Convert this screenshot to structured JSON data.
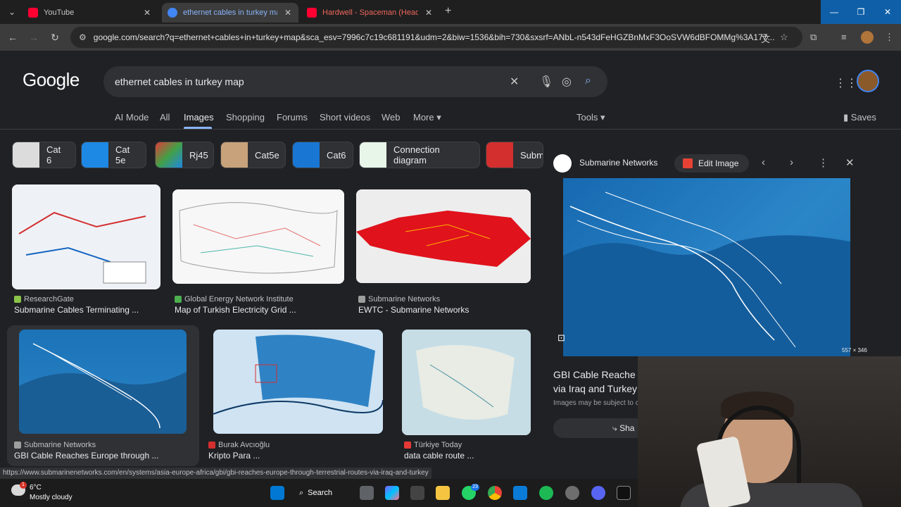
{
  "browser": {
    "tabs": [
      {
        "title": "YouTube",
        "color": "#ff0033"
      },
      {
        "title": "ethernet cables in turkey map",
        "color": "#4285f4"
      },
      {
        "title": "Hardwell - Spaceman (Headhu",
        "color": "#ff0033"
      }
    ],
    "url": "google.com/search?q=ethernet+cables+in+turkey+map&sca_esv=7996c7c19c681191&udm=2&biw=1536&bih=730&sxsrf=ANbL-n543dFeHGZBnMxF3OoSVW6dBFOMMg%3A177..."
  },
  "google": {
    "logo": "Google",
    "query": "ethernet cables in turkey map",
    "filters": [
      "AI Mode",
      "All",
      "Images",
      "Shopping",
      "Forums",
      "Short videos",
      "Web",
      "More"
    ],
    "active_filter": "Images",
    "tools": "Tools",
    "saves": "Saves"
  },
  "chips": [
    "Cat 6",
    "Cat 5e",
    "Rj45",
    "Cat5e",
    "Cat6",
    "Connection diagram",
    "Subm"
  ],
  "results": [
    {
      "source": "ResearchGate",
      "title": "Submarine Cables Terminating ..."
    },
    {
      "source": "Global Energy Network Institute",
      "title": "Map of Turkish Electricity Grid ..."
    },
    {
      "source": "Submarine Networks",
      "title": "EWTC - Submarine Networks"
    },
    {
      "source": "Submarine Networks",
      "title": "GBI Cable Reaches Europe through ..."
    },
    {
      "source": "Burak Avcıoğlu",
      "title": "Kripto Para ..."
    },
    {
      "source": "Türkiye Today",
      "title": "data cable route ..."
    }
  ],
  "preview": {
    "source": "Submarine Networks",
    "edit_label": "Edit Image",
    "dimensions": "557 × 346",
    "title_line1": "GBI Cable Reache",
    "title_line2": "via Iraq and Turkey",
    "copyright": "Images may be subject to c",
    "share": "Sha"
  },
  "status_url": "https://www.submarinenetworks.com/en/systems/asia-europe-africa/gbi/gbi-reaches-europe-through-terrestrial-routes-via-iraq-and-turkey",
  "taskbar": {
    "temp": "6°C",
    "weather": "Mostly cloudy",
    "weather_badge": "1",
    "search": "Search",
    "whatsapp_badge": "23"
  }
}
